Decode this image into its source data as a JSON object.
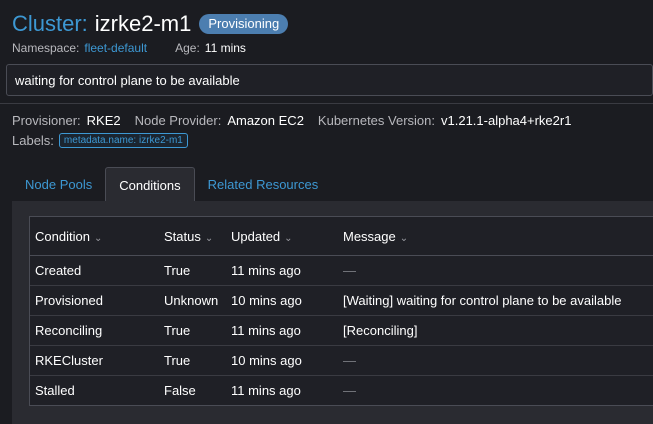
{
  "cluster": {
    "prefix": "Cluster:",
    "name": "izrke2-m1",
    "state": "Provisioning",
    "namespace_label": "Namespace:",
    "namespace": "fleet-default",
    "age_label": "Age:",
    "age": "11 mins"
  },
  "banner": "waiting for control plane to be available",
  "details": {
    "provisioner_label": "Provisioner:",
    "provisioner": "RKE2",
    "node_provider_label": "Node Provider:",
    "node_provider": "Amazon EC2",
    "k8s_label": "Kubernetes Version:",
    "k8s_version": "v1.21.1-alpha4+rke2r1",
    "labels_label": "Labels:",
    "label_chip": "metadata.name: izrke2-m1"
  },
  "tabs": [
    "Node Pools",
    "Conditions",
    "Related Resources"
  ],
  "table": {
    "headers": [
      "Condition",
      "Status",
      "Updated",
      "Message"
    ],
    "sort_icon": "⌄",
    "rows": [
      {
        "condition": "Created",
        "status": "True",
        "updated": "11 mins ago",
        "message": "—"
      },
      {
        "condition": "Provisioned",
        "status": "Unknown",
        "updated": "10 mins ago",
        "message": "[Waiting] waiting for control plane to be available"
      },
      {
        "condition": "Reconciling",
        "status": "True",
        "updated": "11 mins ago",
        "message": "[Reconciling]"
      },
      {
        "condition": "RKECluster",
        "status": "True",
        "updated": "10 mins ago",
        "message": "—"
      },
      {
        "condition": "Stalled",
        "status": "False",
        "updated": "11 mins ago",
        "message": "—"
      }
    ]
  },
  "colors": {
    "accent": "#3d98d3",
    "badge": "#4c7eb0",
    "background": "#1b1c21"
  }
}
